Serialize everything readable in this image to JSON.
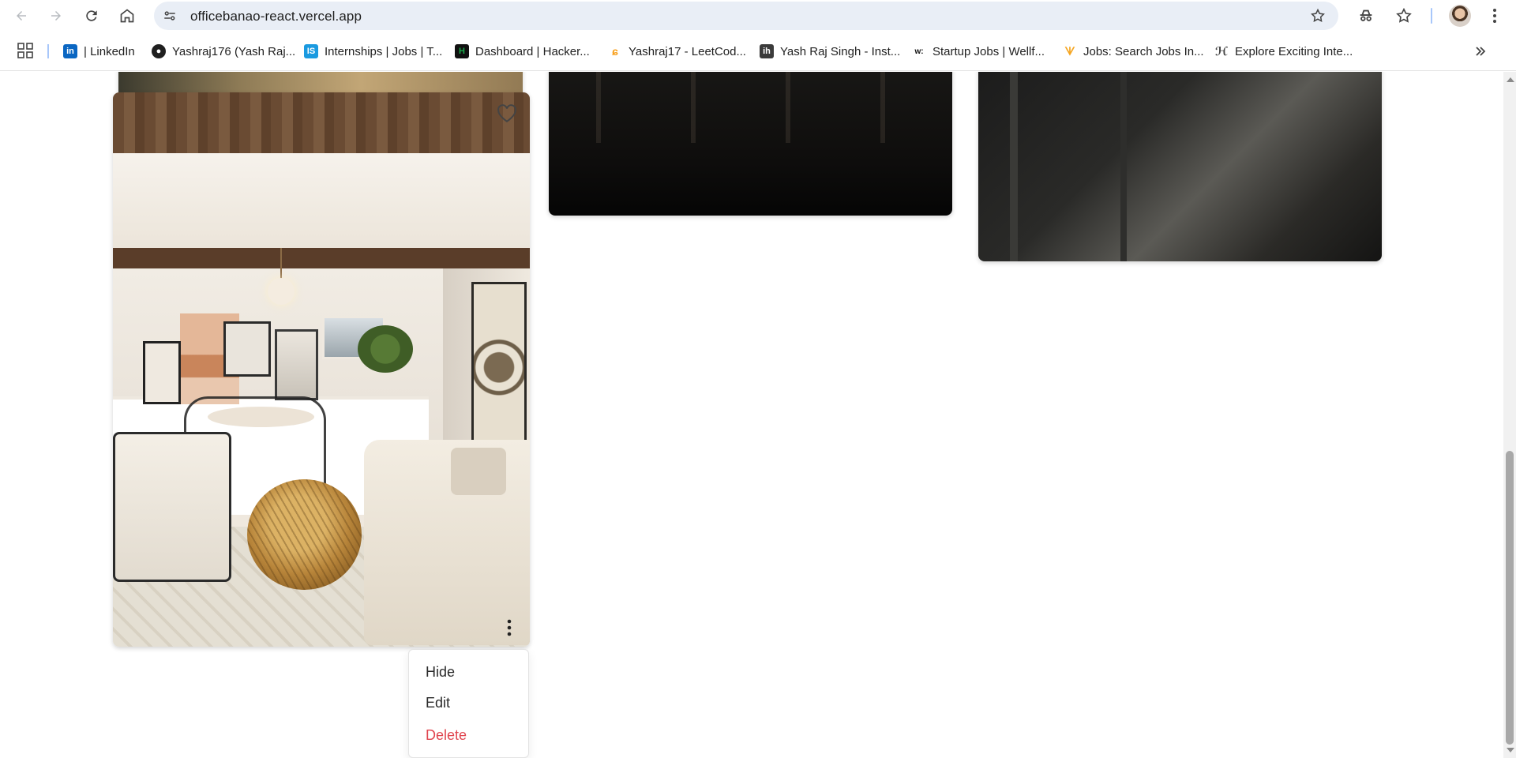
{
  "browser": {
    "url": "officebanao-react.vercel.app",
    "nav_icons": [
      "back-arrow-icon",
      "forward-arrow-icon",
      "reload-icon",
      "home-icon"
    ],
    "right_icons": [
      "bookmark-star-icon",
      "incognito-icon",
      "bookmarks-icon",
      "avatar",
      "kebab-menu-icon"
    ]
  },
  "bookmarks": [
    {
      "label": "| LinkedIn",
      "icon": "linkedin-icon",
      "color": "#0a66c2"
    },
    {
      "label": "Yashraj176 (Yash Raj...",
      "icon": "github-icon",
      "color": "#1f1f1f"
    },
    {
      "label": "Internships | Jobs | T...",
      "icon": "internshala-icon",
      "color": "#1a9ae0"
    },
    {
      "label": "Dashboard | Hacker...",
      "icon": "hackerrank-icon",
      "color": "#1ba94c"
    },
    {
      "label": "Yashraj17 - LeetCod...",
      "icon": "leetcode-icon",
      "color": "#f89f1b"
    },
    {
      "label": "Yash Raj Singh - Inst...",
      "icon": "instahyre-icon",
      "color": "#3b3b3b"
    },
    {
      "label": "Startup Jobs | Wellf...",
      "icon": "wellfound-icon",
      "color": "#111111"
    },
    {
      "label": "Jobs: Search Jobs In...",
      "icon": "naukri-icon",
      "color": "#f5a623"
    },
    {
      "label": "Explore Exciting Inte...",
      "icon": "hirect-icon",
      "color": "#444444"
    }
  ],
  "card": {
    "like_icon": "heart-outline-icon",
    "options_icon": "more-vertical-icon"
  },
  "menu": {
    "items": [
      {
        "label": "Hide"
      },
      {
        "label": "Edit"
      },
      {
        "label": "Delete",
        "color": "#e0454f"
      }
    ]
  }
}
